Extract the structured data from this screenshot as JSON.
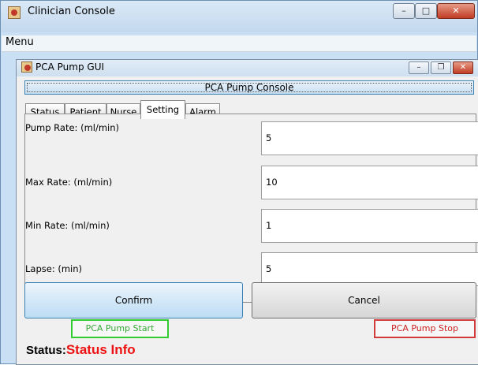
{
  "window": {
    "title": "Clinician Console",
    "minimize": "–",
    "maximize": "□",
    "close": "✕"
  },
  "menubar": {
    "menu": "Menu"
  },
  "internal_frame": {
    "title": "PCA Pump GUI",
    "minimize": "–",
    "restore": "❐",
    "close": "✕"
  },
  "console_button": "PCA Pump Console",
  "tabs": [
    {
      "label": "Status",
      "active": false
    },
    {
      "label": "Patient",
      "active": false
    },
    {
      "label": "Nurse",
      "active": false
    },
    {
      "label": "Setting",
      "active": true
    },
    {
      "label": "Alarm",
      "active": false
    }
  ],
  "settings": [
    {
      "label": "Pump Rate: (ml/min)",
      "value": "5"
    },
    {
      "label": "Max Rate: (ml/min)",
      "value": "10"
    },
    {
      "label": "Min Rate: (ml/min)",
      "value": "1"
    },
    {
      "label": "Lapse: (min)",
      "value": "5"
    }
  ],
  "buttons": {
    "confirm": "Confirm",
    "cancel": "Cancel"
  },
  "pump_controls": {
    "start": "PCA Pump Start",
    "stop": "PCA Pump Stop"
  },
  "status": {
    "label": "Status:",
    "info": "Status Info"
  },
  "colors": {
    "start_border": "#33cc33",
    "stop_border": "#d23c3c",
    "status_info": "#ee1111"
  },
  "icons": {
    "app": "java-cup-icon"
  }
}
